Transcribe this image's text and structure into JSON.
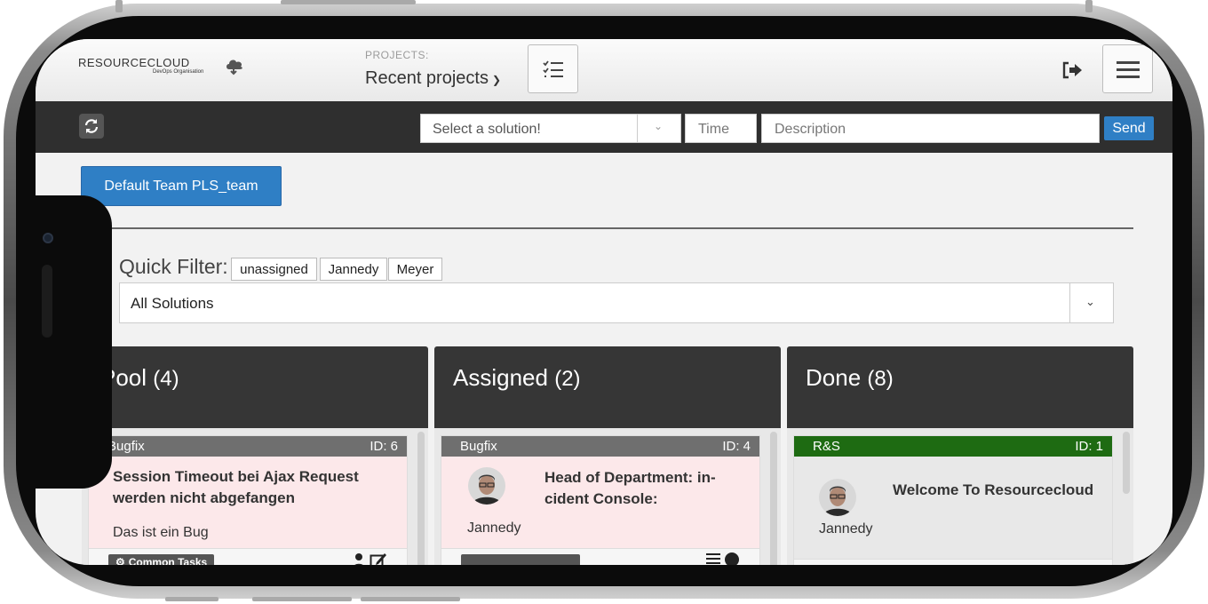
{
  "header": {
    "logo_text": "RESOURCECLOUD",
    "logo_sub": "DevOps Organisation",
    "projects_label": "PROJECTS:",
    "projects_value": "Recent projects"
  },
  "toolbar": {
    "solution_placeholder": "Select a solution!",
    "time_placeholder": "Time",
    "description_placeholder": "Description",
    "send_label": "Send"
  },
  "team_button": "Default Team PLS_team",
  "quick_filter": {
    "label": "Quick Filter:",
    "tags": [
      "unassigned",
      "Jannedy",
      "Meyer"
    ]
  },
  "solution_filter": "All Solutions",
  "columns": [
    {
      "title": "Pool",
      "count": "(4)",
      "card": {
        "type": "Bugfix",
        "id": "ID: 6",
        "title": "Session Timeout bei Ajax Request werden nicht abgefangen",
        "description": "Das ist ein Bug",
        "footer_tag": "Common Tasks"
      }
    },
    {
      "title": "Assigned",
      "count": "(2)",
      "card": {
        "type": "Bugfix",
        "id": "ID: 4",
        "title": "Head of Department: in-cident Console:",
        "assignee": "Jannedy"
      }
    },
    {
      "title": "Done",
      "count": "(8)",
      "card": {
        "type": "R&S",
        "id": "ID: 1",
        "title": "Welcome To Resourcecloud",
        "assignee": "Jannedy"
      }
    }
  ],
  "colors": {
    "primary": "#2f7fc5",
    "toolbar": "#2f2f2f",
    "column_header": "#363636",
    "bugfix_bar": "#6f6f6f",
    "rs_bar": "#1e6b12",
    "card_pink": "#fce8ea"
  }
}
